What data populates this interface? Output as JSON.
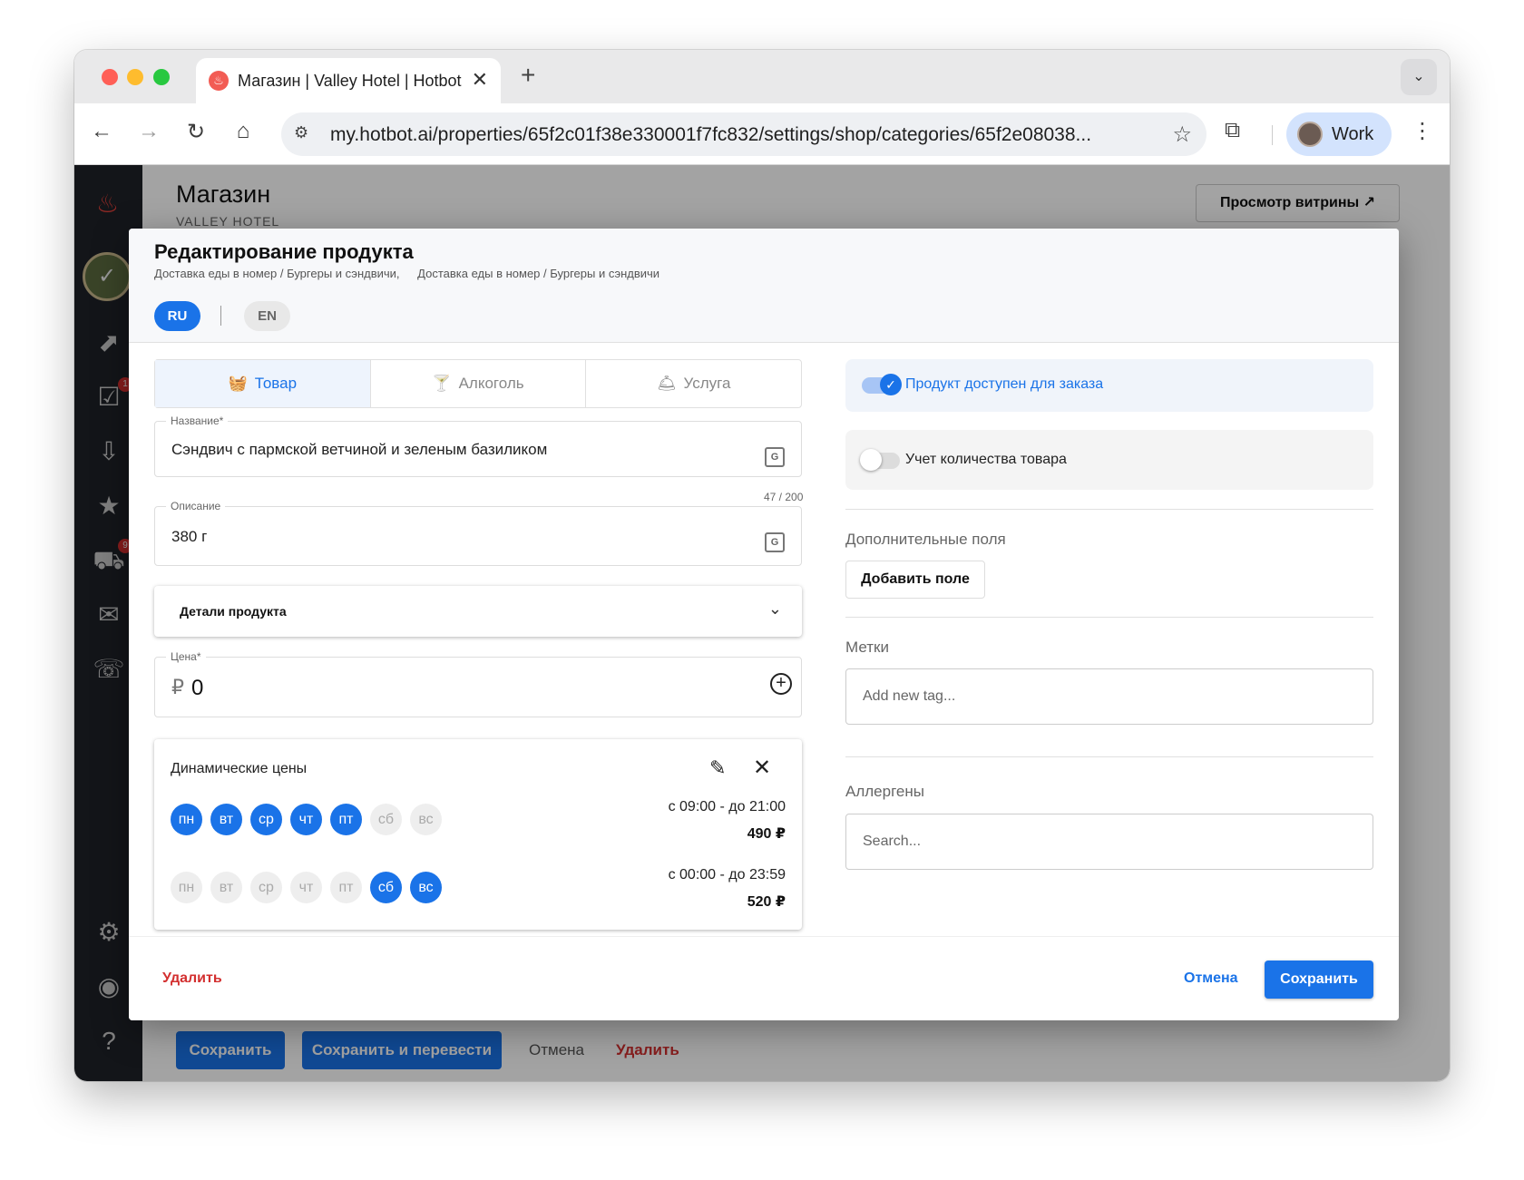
{
  "browser": {
    "tab_title": "Магазин | Valley Hotel | Hotbot",
    "new_tab_icon": "plus-icon",
    "url": "my.hotbot.ai/properties/65f2c01f38e330001f7fc832/settings/shop/categories/65f2e08038...",
    "profile_label": "Work"
  },
  "sidebar": {
    "icons": [
      "flame-logo",
      "property-avatar",
      "analytics-icon",
      "tasks-icon",
      "inbox-icon",
      "reviews-icon",
      "cart-icon",
      "send-icon",
      "chat-icon",
      "settings-icon",
      "account-icon",
      "help-icon"
    ],
    "badges": {
      "tasks": "1",
      "cart": "9"
    }
  },
  "page": {
    "title": "Магазин",
    "subtitle": "VALLEY HOTEL",
    "storefront_button": "Просмотр витрины ↗",
    "bottom_bar": {
      "save": "Сохранить",
      "save_translate": "Сохранить и перевести",
      "cancel": "Отмена",
      "delete": "Удалить"
    }
  },
  "modal": {
    "title": "Редактирование продукта",
    "breadcrumbs": [
      "Доставка еды в номер / Бургеры и сэндвичи,",
      "Доставка еды в номер / Бургеры и сэндвичи"
    ],
    "languages": [
      "RU",
      "EN"
    ],
    "active_language": "RU",
    "product_types": [
      {
        "label": "Товар",
        "icon": "basket-icon",
        "active": true
      },
      {
        "label": "Алкоголь",
        "icon": "cocktail-icon",
        "active": false
      },
      {
        "label": "Услуга",
        "icon": "service-icon",
        "active": false
      }
    ],
    "name_field": {
      "label": "Название*",
      "value": "Сэндвич с пармской ветчиной и зеленым базиликом",
      "counter": "47 / 200"
    },
    "description_field": {
      "label": "Описание",
      "value": "380 г"
    },
    "details_label": "Детали продукта",
    "price_field": {
      "label": "Цена*",
      "currency": "₽",
      "value": "0"
    },
    "dynamic_prices": {
      "title": "Динамические цены",
      "rules": [
        {
          "days": [
            {
              "label": "пн",
              "on": true
            },
            {
              "label": "вт",
              "on": true
            },
            {
              "label": "ср",
              "on": true
            },
            {
              "label": "чт",
              "on": true
            },
            {
              "label": "пт",
              "on": true
            },
            {
              "label": "сб",
              "on": false
            },
            {
              "label": "вс",
              "on": false
            }
          ],
          "time": "с 09:00 - до 21:00",
          "price": "490 ₽"
        },
        {
          "days": [
            {
              "label": "пн",
              "on": false
            },
            {
              "label": "вт",
              "on": false
            },
            {
              "label": "ср",
              "on": false
            },
            {
              "label": "чт",
              "on": false
            },
            {
              "label": "пт",
              "on": false
            },
            {
              "label": "сб",
              "on": true
            },
            {
              "label": "вс",
              "on": true
            }
          ],
          "time": "с 00:00 - до 23:59",
          "price": "520 ₽"
        }
      ]
    },
    "available_toggle": {
      "label": "Продукт доступен для заказа",
      "on": true
    },
    "stock_toggle": {
      "label": "Учет количества товара",
      "on": false
    },
    "extra_fields": {
      "label": "Дополнительные поля",
      "button": "Добавить поле"
    },
    "tags": {
      "label": "Метки",
      "placeholder": "Add new tag..."
    },
    "allergens": {
      "label": "Аллергены",
      "placeholder": "Search..."
    },
    "footer": {
      "delete": "Удалить",
      "cancel": "Отмена",
      "save": "Сохранить"
    }
  },
  "colors": {
    "primary": "#1a73e8",
    "danger": "#d32f2f",
    "sidebar": "#1f2228"
  }
}
